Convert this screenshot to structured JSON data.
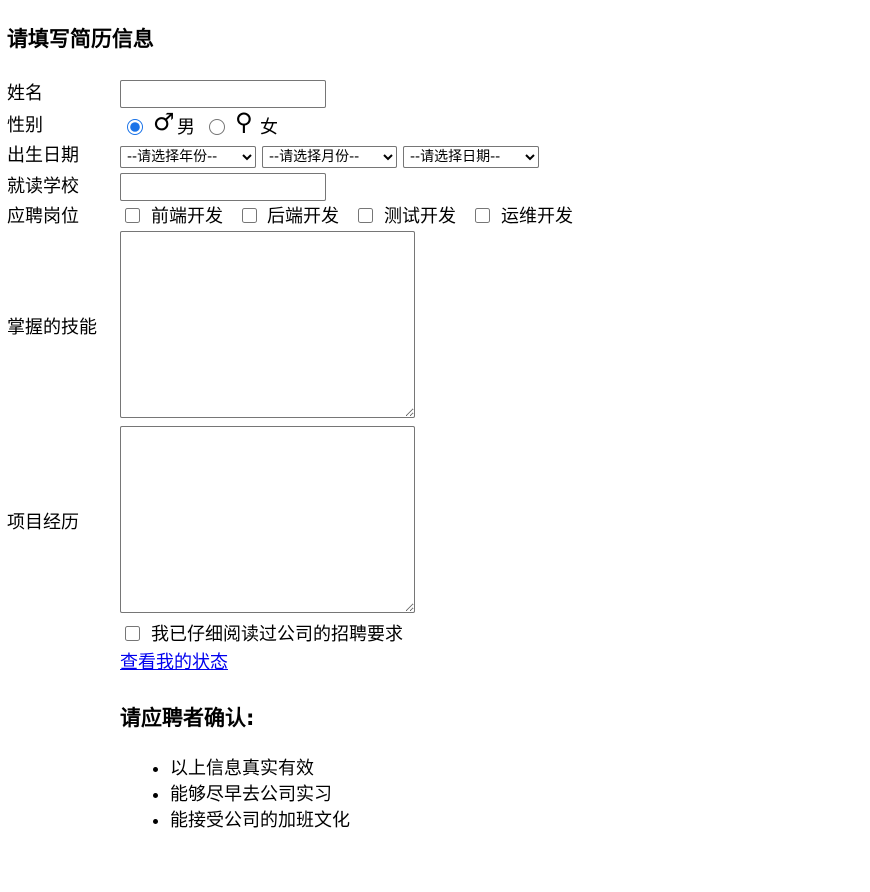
{
  "form": {
    "title": "请填写简历信息",
    "name": {
      "label": "姓名",
      "value": ""
    },
    "gender": {
      "label": "性别",
      "male_label": "男",
      "female_label": "女",
      "male_symbol": "♂",
      "female_symbol": "⚲",
      "selected": "male"
    },
    "birthdate": {
      "label": "出生日期",
      "year_select": "--请选择年份--",
      "month_select": "--请选择月份--",
      "day_select": "--请选择日期--"
    },
    "school": {
      "label": "就读学校",
      "value": ""
    },
    "position": {
      "label": "应聘岗位",
      "options": [
        "前端开发",
        "后端开发",
        "测试开发",
        "运维开发"
      ]
    },
    "skills": {
      "label": "掌握的技能",
      "value": ""
    },
    "projects": {
      "label": "项目经历",
      "value": ""
    },
    "agreement": {
      "label": "我已仔细阅读过公司的招聘要求",
      "checked": false
    },
    "status_link": "查看我的状态"
  },
  "confirm": {
    "heading": "请应聘者确认:",
    "items": [
      "以上信息真实有效",
      "能够尽早去公司实习",
      "能接受公司的加班文化"
    ]
  },
  "colors": {
    "link": "#0000ee",
    "accent": "#1a73e8",
    "border": "#767676"
  }
}
